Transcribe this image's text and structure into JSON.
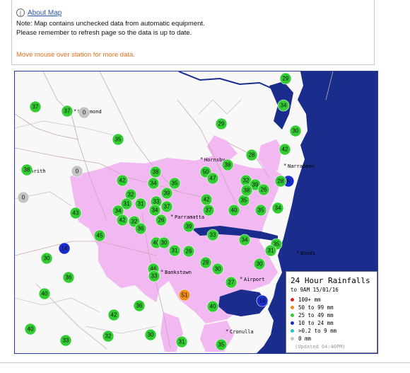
{
  "info": {
    "about_link": "About Map",
    "note_line1": "Note: Map contains unchecked data from automatic equipment.",
    "note_line2": "Please remember to refresh page so the data is up to date.",
    "hover_hint": "Move mouse over station for more data."
  },
  "towns": [
    {
      "name": "Richmond"
    },
    {
      "name": "Penrith"
    },
    {
      "name": "Hornsby"
    },
    {
      "name": "Narrabeen"
    },
    {
      "name": "Parramatta"
    },
    {
      "name": "Bondi"
    },
    {
      "name": "Bankstown"
    },
    {
      "name": "Airport"
    },
    {
      "name": "Cronulla"
    }
  ],
  "stations": [
    {
      "value": "29",
      "color": "#33cc33"
    },
    {
      "value": "37",
      "color": "#33cc33"
    },
    {
      "value": "37",
      "color": "#33cc33"
    },
    {
      "value": "0",
      "color": "#c4c4c4"
    },
    {
      "value": "34",
      "color": "#33cc33"
    },
    {
      "value": "30",
      "color": "#33cc33"
    },
    {
      "value": "35",
      "color": "#33cc33"
    },
    {
      "value": "29",
      "color": "#33cc33"
    },
    {
      "value": "42",
      "color": "#33cc33"
    },
    {
      "value": "28",
      "color": "#33cc33"
    },
    {
      "value": "38",
      "color": "#33cc33"
    },
    {
      "value": "0",
      "color": "#c4c4c4"
    },
    {
      "value": "38",
      "color": "#33cc33"
    },
    {
      "value": "50",
      "color": "#33cc33"
    },
    {
      "value": "47",
      "color": "#33cc33"
    },
    {
      "value": "32",
      "color": "#33cc33"
    },
    {
      "value": "39",
      "color": "#33cc33"
    },
    {
      "value": "5",
      "color": "#1a2ccc"
    },
    {
      "value": "28",
      "color": "#33cc33"
    },
    {
      "value": "0",
      "color": "#c4c4c4"
    },
    {
      "value": "42",
      "color": "#33cc33"
    },
    {
      "value": "38",
      "color": "#33cc33"
    },
    {
      "value": "34",
      "color": "#33cc33"
    },
    {
      "value": "35",
      "color": "#33cc33"
    },
    {
      "value": "32",
      "color": "#33cc33"
    },
    {
      "value": "39",
      "color": "#33cc33"
    },
    {
      "value": "31",
      "color": "#33cc33"
    },
    {
      "value": "33",
      "color": "#33cc33"
    },
    {
      "value": "31",
      "color": "#33cc33"
    },
    {
      "value": "37",
      "color": "#33cc33"
    },
    {
      "value": "34",
      "color": "#33cc33"
    },
    {
      "value": "34",
      "color": "#33cc33"
    },
    {
      "value": "43",
      "color": "#33cc33"
    },
    {
      "value": "42",
      "color": "#33cc33"
    },
    {
      "value": "32",
      "color": "#33cc33"
    },
    {
      "value": "36",
      "color": "#33cc33"
    },
    {
      "value": "26",
      "color": "#33cc33"
    },
    {
      "value": "42",
      "color": "#33cc33"
    },
    {
      "value": "37",
      "color": "#33cc33"
    },
    {
      "value": "40",
      "color": "#33cc33"
    },
    {
      "value": "35",
      "color": "#33cc33"
    },
    {
      "value": "38",
      "color": "#33cc33"
    },
    {
      "value": "26",
      "color": "#33cc33"
    },
    {
      "value": "35",
      "color": "#33cc33"
    },
    {
      "value": "34",
      "color": "#33cc33"
    },
    {
      "value": "39",
      "color": "#33cc33"
    },
    {
      "value": "45",
      "color": "#33cc33"
    },
    {
      "value": "33",
      "color": "#33cc33"
    },
    {
      "value": "14",
      "color": "#1a2ccc"
    },
    {
      "value": "40",
      "color": "#33cc33"
    },
    {
      "value": "30",
      "color": "#33cc33"
    },
    {
      "value": "31",
      "color": "#33cc33"
    },
    {
      "value": "26",
      "color": "#33cc33"
    },
    {
      "value": "34",
      "color": "#33cc33"
    },
    {
      "value": "35",
      "color": "#33cc33"
    },
    {
      "value": "31",
      "color": "#33cc33"
    },
    {
      "value": "30",
      "color": "#33cc33"
    },
    {
      "value": "28",
      "color": "#33cc33"
    },
    {
      "value": "30",
      "color": "#33cc33"
    },
    {
      "value": "30",
      "color": "#33cc33"
    },
    {
      "value": "36",
      "color": "#33cc33"
    },
    {
      "value": "46",
      "color": "#33cc33"
    },
    {
      "value": "33",
      "color": "#33cc33"
    },
    {
      "value": "27",
      "color": "#33cc33"
    },
    {
      "value": "51",
      "color": "#f08c1e"
    },
    {
      "value": "40",
      "color": "#33cc33"
    },
    {
      "value": "19",
      "color": "#1a2ccc"
    },
    {
      "value": "40",
      "color": "#33cc33"
    },
    {
      "value": "36",
      "color": "#33cc33"
    },
    {
      "value": "42",
      "color": "#33cc33"
    },
    {
      "value": "40",
      "color": "#33cc33"
    },
    {
      "value": "32",
      "color": "#33cc33"
    },
    {
      "value": "30",
      "color": "#33cc33"
    },
    {
      "value": "33",
      "color": "#33cc33"
    },
    {
      "value": "31",
      "color": "#33cc33"
    },
    {
      "value": "35",
      "color": "#33cc33"
    }
  ],
  "legend": {
    "title": "24 Hour Rainfalls",
    "subtitle": "to 9AM 15/01/16",
    "rows": [
      {
        "label": "100+ mm",
        "color": "#e02020"
      },
      {
        "label": "50  to 99 mm",
        "color": "#f08c1e"
      },
      {
        "label": "25  to 49 mm",
        "color": "#33cc33"
      },
      {
        "label": "10  to 24 mm",
        "color": "#1a2ccc"
      },
      {
        "label": ">0.2 to 9 mm",
        "color": "#20c8c8"
      },
      {
        "label": "0 mm",
        "color": "#c4c4c4"
      }
    ],
    "updated": "(Updated 04:40PM)"
  },
  "colors": {
    "urban": "#f2b8f2",
    "water": "#1a2c8c",
    "road": "#c8a8b8",
    "land": "#f8f8f8"
  }
}
